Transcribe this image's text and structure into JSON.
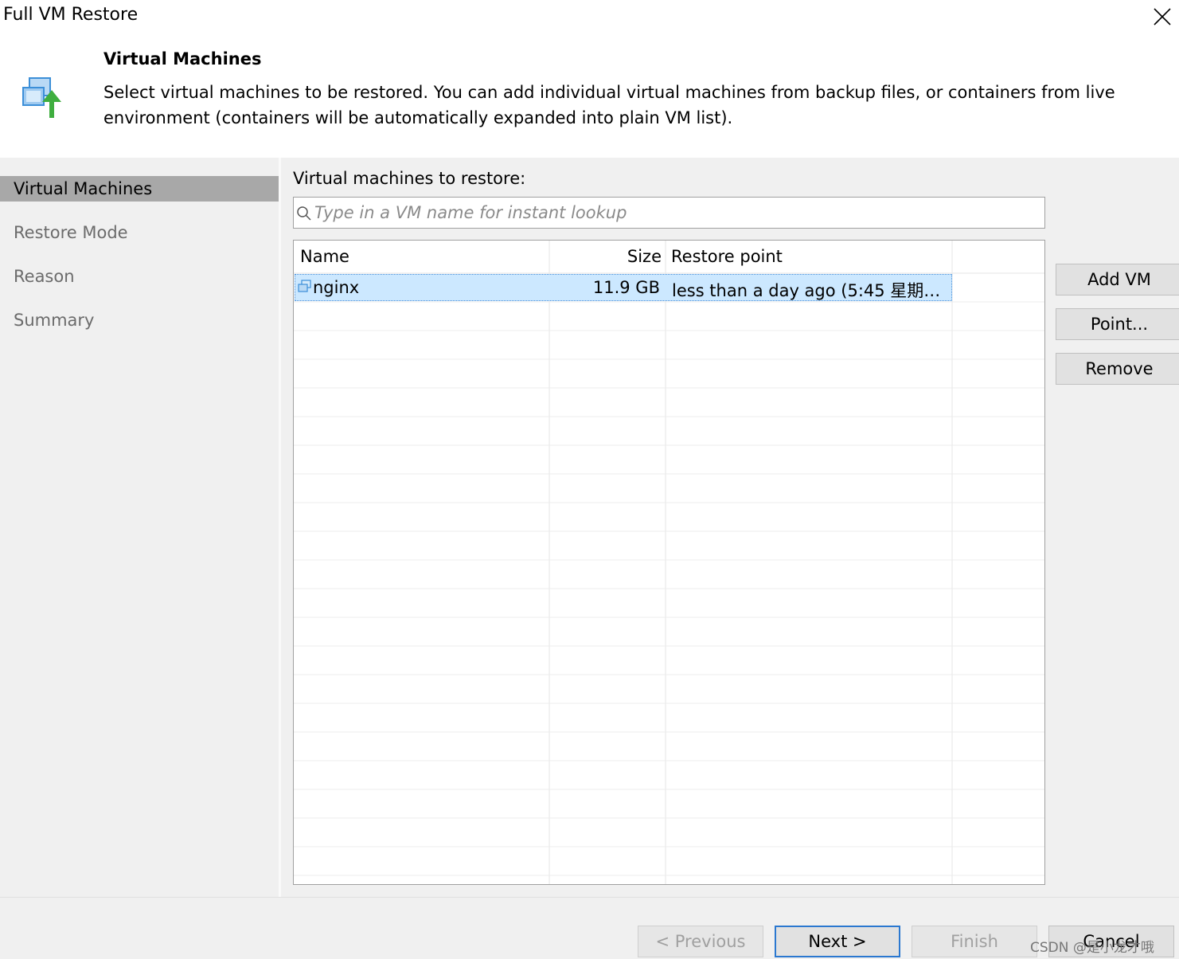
{
  "window": {
    "title": "Full VM Restore"
  },
  "header": {
    "icon": "vm-restore-icon",
    "title": "Virtual Machines",
    "description": "Select virtual machines to be restored. You can add individual virtual machines from backup files, or containers from live environment (containers will be automatically expanded into plain VM list)."
  },
  "nav": {
    "items": [
      {
        "label": "Virtual Machines",
        "active": true
      },
      {
        "label": "Restore Mode",
        "active": false
      },
      {
        "label": "Reason",
        "active": false
      },
      {
        "label": "Summary",
        "active": false
      }
    ]
  },
  "main": {
    "label": "Virtual machines to restore:",
    "search": {
      "placeholder": "Type in a VM name for instant lookup",
      "value": ""
    },
    "table": {
      "columns": [
        "Name",
        "Size",
        "Restore point"
      ],
      "rows": [
        {
          "name": "nginx",
          "size": "11.9 GB",
          "restore_point": "less than a day ago (5:45 星期…",
          "selected": true
        }
      ]
    },
    "buttons": {
      "add_vm": "Add VM",
      "point": "Point...",
      "remove": "Remove"
    }
  },
  "footer": {
    "previous": "< Previous",
    "next": "Next >",
    "finish": "Finish",
    "cancel": "Cancel",
    "watermark": "CSDN @是小龙才哦"
  },
  "colors": {
    "selection": "#cce8ff",
    "nav_active": "#a8a8a8",
    "accent": "#2b78d0",
    "icon_green": "#3fae3f",
    "icon_blue": "#3c8fd8"
  }
}
